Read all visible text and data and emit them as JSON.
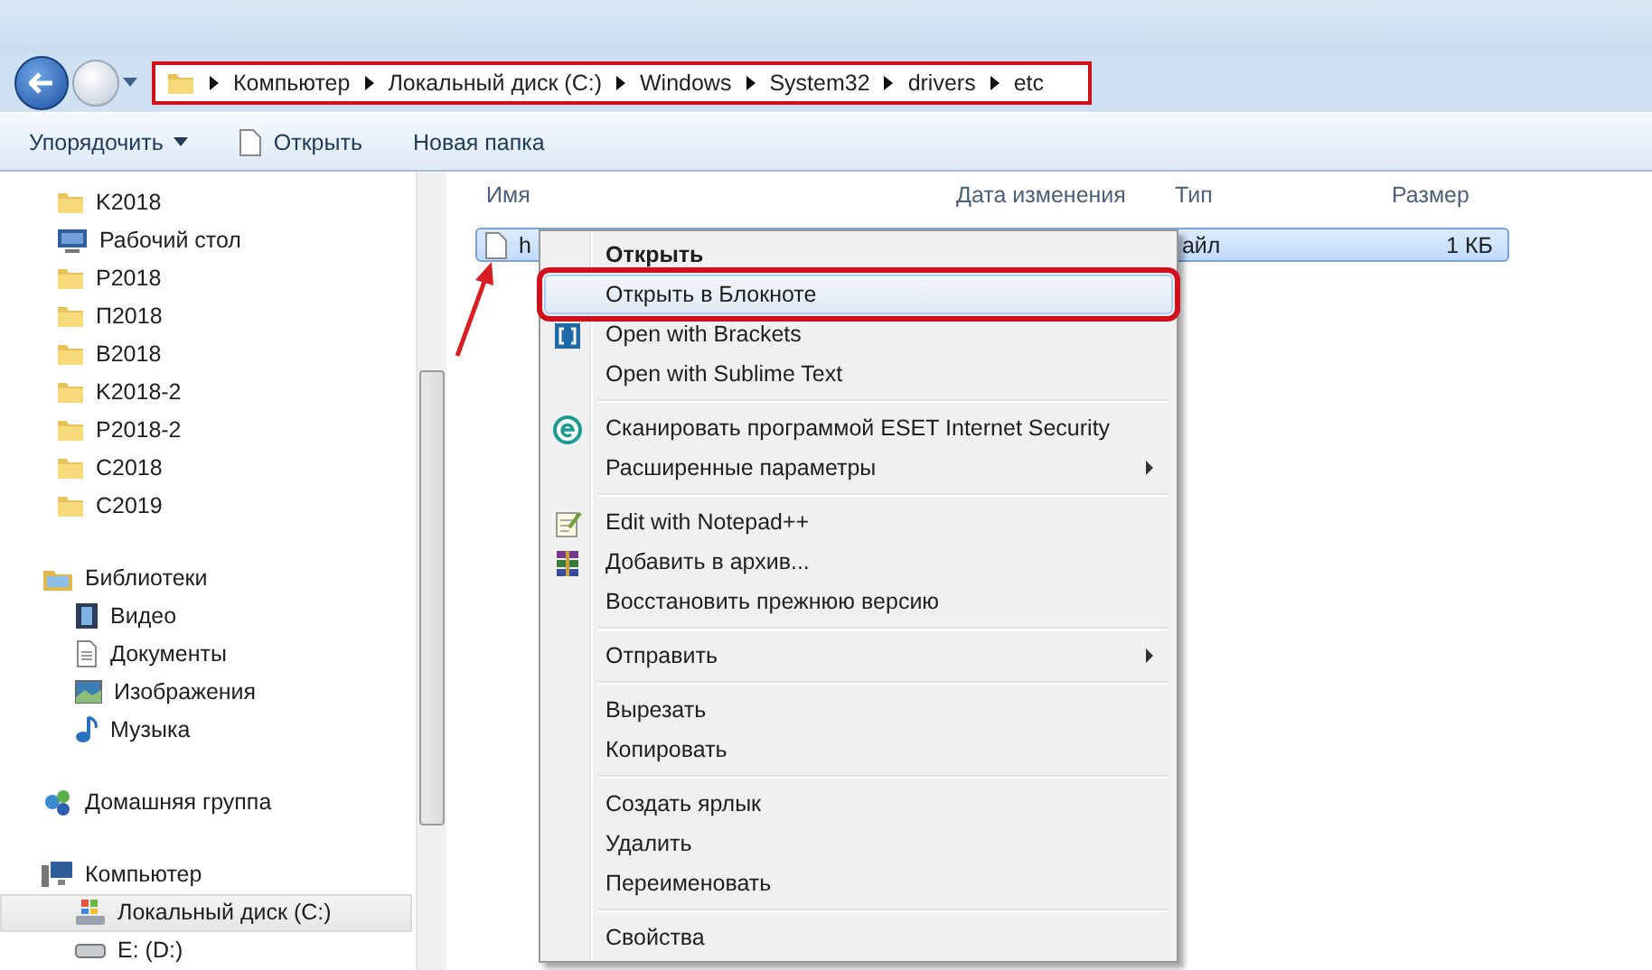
{
  "address_bar": {
    "marked": true,
    "crumbs": [
      "Компьютер",
      "Локальный диск (C:)",
      "Windows",
      "System32",
      "drivers",
      "etc"
    ]
  },
  "toolbar": [
    {
      "label": "Упорядочить",
      "kind": "dropdown"
    },
    {
      "label": "Открыть",
      "kind": "file"
    },
    {
      "label": "Новая папка",
      "kind": "plain"
    }
  ],
  "sidebar": {
    "sections": [
      {
        "items": [
          {
            "label": "K2018",
            "kind": "folder",
            "selected": false
          },
          {
            "label": "Рабочий стол",
            "kind": "desktop",
            "selected": false
          },
          {
            "label": "P2018",
            "kind": "folder",
            "selected": false
          },
          {
            "label": "П2018",
            "kind": "folder",
            "selected": false
          },
          {
            "label": "B2018",
            "kind": "folder",
            "selected": false
          },
          {
            "label": "K2018-2",
            "kind": "folder",
            "selected": false
          },
          {
            "label": "P2018-2",
            "kind": "folder",
            "selected": false
          },
          {
            "label": "C2018",
            "kind": "folder",
            "selected": false
          },
          {
            "label": "C2019",
            "kind": "folder",
            "selected": false
          }
        ]
      },
      {
        "label": "Библиотеки",
        "kind": "library",
        "selected": false,
        "children": [
          {
            "label": "Видео",
            "kind": "video",
            "selected": false
          },
          {
            "label": "Документы",
            "kind": "document",
            "selected": false
          },
          {
            "label": "Изображения",
            "kind": "image",
            "selected": false
          },
          {
            "label": "Музыка",
            "kind": "music",
            "selected": false
          }
        ]
      },
      {
        "label": "Домашняя группа",
        "kind": "homegroup",
        "selected": false
      },
      {
        "label": "Компьютер",
        "kind": "computer",
        "selected": false,
        "children": [
          {
            "label": "Локальный диск (C:)",
            "kind": "system-drive",
            "selected": true
          },
          {
            "label": "E: (D:)",
            "kind": "drive",
            "selected": false
          }
        ]
      }
    ]
  },
  "table": {
    "columns": [
      "Имя",
      "Дата изменения",
      "Тип",
      "Размер"
    ],
    "rows": [
      {
        "name": "h",
        "type": "айл",
        "size": "1 КБ",
        "selected": true,
        "pointed": true
      }
    ]
  },
  "context_menu": {
    "items": [
      {
        "kind": "item",
        "label": "Открыть",
        "bold": true,
        "selected": false
      },
      {
        "kind": "item",
        "label": "Открыть в Блокноте",
        "selected": true,
        "marked": true
      },
      {
        "kind": "brackets",
        "label": "Open with Brackets",
        "selected": false
      },
      {
        "kind": "item",
        "label": "Open with Sublime Text",
        "selected": false
      },
      {
        "kind": "separator"
      },
      {
        "kind": "scan",
        "label": "Сканировать программой ESET Internet Security",
        "selected": false
      },
      {
        "kind": "item",
        "label": "Расширенные параметры",
        "submenu": true,
        "selected": false
      },
      {
        "kind": "separator"
      },
      {
        "kind": "notepad",
        "label": "Edit with Notepad++",
        "selected": false
      },
      {
        "kind": "archive",
        "label": "Добавить в архив...",
        "selected": false
      },
      {
        "kind": "item",
        "label": "Восстановить прежнюю версию",
        "selected": false
      },
      {
        "kind": "separator"
      },
      {
        "kind": "item",
        "label": "Отправить",
        "submenu": true,
        "selected": false
      },
      {
        "kind": "separator"
      },
      {
        "kind": "item",
        "label": "Вырезать",
        "selected": false
      },
      {
        "kind": "item",
        "label": "Копировать",
        "selected": false
      },
      {
        "kind": "separator"
      },
      {
        "kind": "item",
        "label": "Создать ярлык",
        "selected": false
      },
      {
        "kind": "item",
        "label": "Удалить",
        "selected": false
      },
      {
        "kind": "item",
        "label": "Переименовать",
        "selected": false
      },
      {
        "kind": "separator"
      },
      {
        "kind": "item",
        "label": "Свойства",
        "selected": false
      }
    ]
  }
}
